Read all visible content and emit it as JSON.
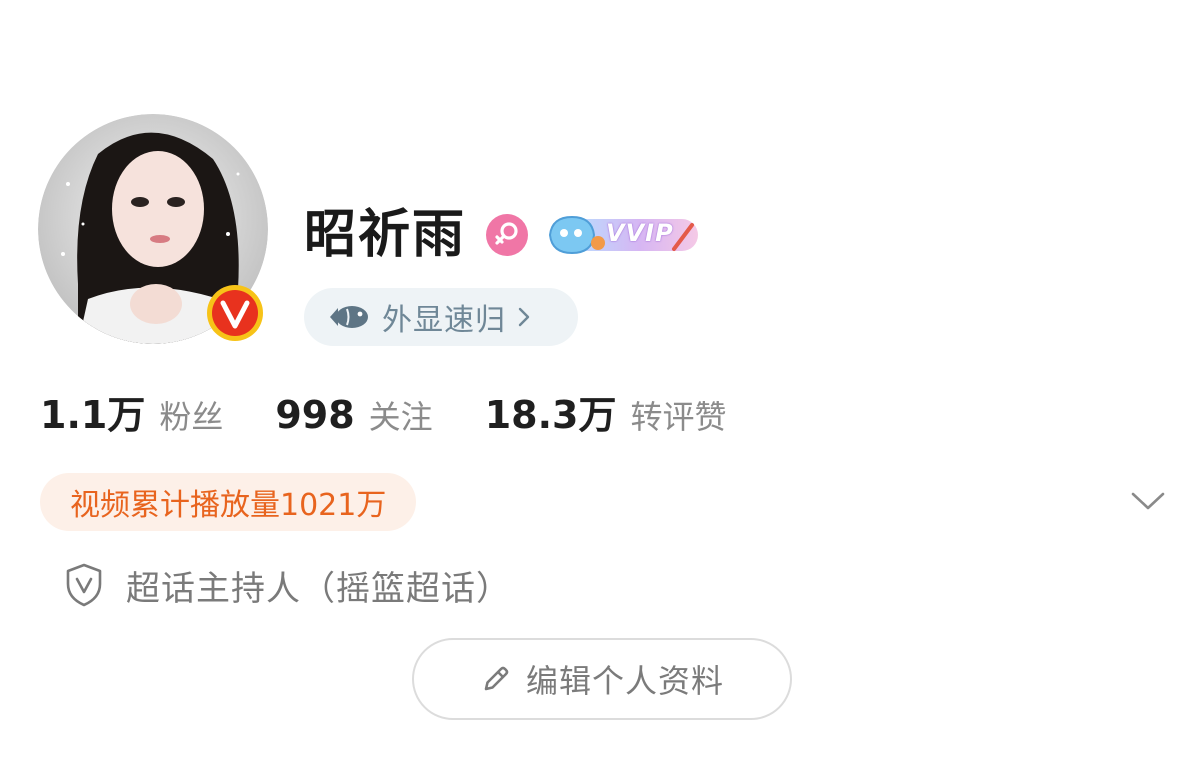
{
  "profile": {
    "name": "昭祈雨",
    "vip_label": "VVIP",
    "fish_label": "外显速归",
    "stats": [
      {
        "value": "1.1万",
        "label": "粉丝"
      },
      {
        "value": "998",
        "label": "关注"
      },
      {
        "value": "18.3万",
        "label": "转评赞"
      }
    ],
    "plays_badge": "视频累计播放量1021万",
    "host_text": "超话主持人（摇篮超话）",
    "edit_button": "编辑个人资料"
  },
  "icons": {
    "verified": "verified-v-icon",
    "gender": "female-icon",
    "fish": "fish-icon",
    "chevron_right": "chevron-right-icon",
    "chevron_down": "chevron-down-icon",
    "shield": "shield-v-icon",
    "pencil": "pencil-icon"
  },
  "colors": {
    "verified_badge": "#e8321e",
    "gender_pink": "#f076a6",
    "plays_text": "#e8641e",
    "plays_bg": "#fdf0e8",
    "fish_pill_bg": "#eef3f6"
  }
}
